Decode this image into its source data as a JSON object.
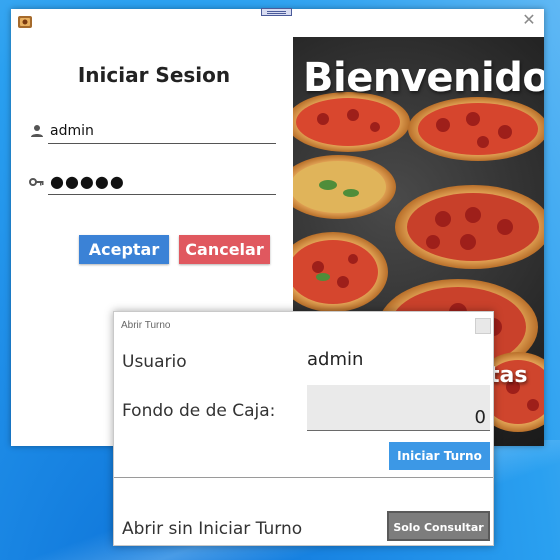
{
  "login": {
    "title": "Iniciar Sesion",
    "username_value": "admin",
    "password_value": "●●●●●",
    "accept_label": "Aceptar",
    "cancel_label": "Cancelar",
    "close_glyph": "✕",
    "app_icon": "app-logo-icon",
    "user_icon": "user-icon",
    "key_icon": "key-icon"
  },
  "hero": {
    "title": "Bienvenido",
    "subtitle_fragment": "tas"
  },
  "dialog": {
    "title": "Abrir Turno",
    "usuario_label": "Usuario",
    "usuario_value": "admin",
    "fondo_label": "Fondo de de Caja:",
    "fondo_value": "0",
    "iniciar_label": "Iniciar Turno",
    "sin_iniciar_label": "Abrir sin Iniciar Turno",
    "consultar_label": "Solo Consultar"
  },
  "colors": {
    "accept": "#3b82d6",
    "cancel": "#e0585f",
    "iniciar": "#3c98e6",
    "consultar": "#7d7d7d"
  }
}
